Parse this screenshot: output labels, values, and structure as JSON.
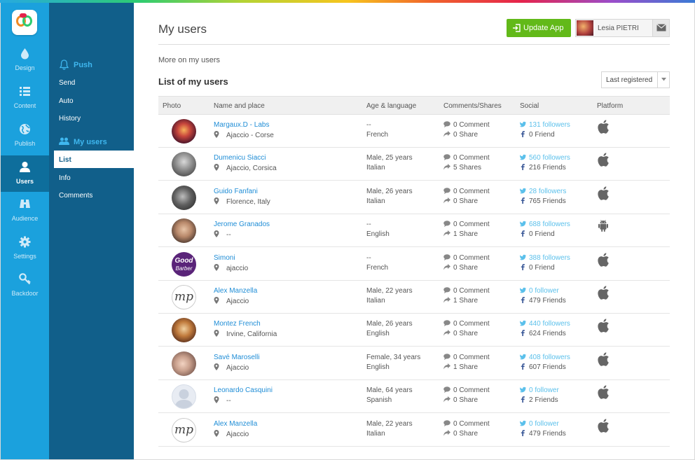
{
  "sidebar": {
    "items": [
      {
        "label": "Design",
        "icon": "drop-icon"
      },
      {
        "label": "Content",
        "icon": "list-icon"
      },
      {
        "label": "Publish",
        "icon": "globe-icon"
      },
      {
        "label": "Users",
        "icon": "user-icon",
        "active": true
      },
      {
        "label": "Audience",
        "icon": "binoculars-icon"
      },
      {
        "label": "Settings",
        "icon": "gear-icon"
      },
      {
        "label": "Backdoor",
        "icon": "key-icon"
      }
    ]
  },
  "subnav": {
    "push_title": "Push",
    "push_items": [
      "Send",
      "Auto",
      "History"
    ],
    "users_title": "My users",
    "users_items": [
      "List",
      "Info",
      "Comments"
    ],
    "active_item": "List"
  },
  "header": {
    "title": "My users",
    "update_button": "Update App",
    "user_name": "Lesia PIETRI"
  },
  "main": {
    "more_link": "More on my users",
    "list_title": "List of my users",
    "sort_value": "Last registered"
  },
  "table": {
    "columns": [
      "Photo",
      "Name and place",
      "Age & language",
      "Comments/Shares",
      "Social",
      "Platform"
    ],
    "rows": [
      {
        "name": "Margaux.D - Labs",
        "place": "Ajaccio - Corse",
        "age": "--",
        "language": "French",
        "comments": "0 Comment",
        "shares": "0 Share",
        "twitter": "131 followers",
        "facebook": "0 Friend",
        "platform": "apple"
      },
      {
        "name": "Dumenicu Siacci",
        "place": "Ajaccio, Corsica",
        "age": "Male, 25 years",
        "language": "Italian",
        "comments": "0 Comment",
        "shares": "5 Shares",
        "twitter": "560 followers",
        "facebook": "216 Friends",
        "platform": "apple"
      },
      {
        "name": "Guido Fanfani",
        "place": "Florence, Italy",
        "age": "Male, 26 years",
        "language": "Italian",
        "comments": "0 Comment",
        "shares": "0 Share",
        "twitter": "28 followers",
        "facebook": "765 Friends",
        "platform": "apple"
      },
      {
        "name": "Jerome Granados",
        "place": "--",
        "age": "--",
        "language": "English",
        "comments": "0 Comment",
        "shares": "1 Share",
        "twitter": "688 followers",
        "facebook": "0 Friend",
        "platform": "android"
      },
      {
        "name": "Simoni",
        "place": "ajaccio",
        "age": "--",
        "language": "French",
        "comments": "0 Comment",
        "shares": "0 Share",
        "twitter": "388 followers",
        "facebook": "0 Friend",
        "platform": "apple"
      },
      {
        "name": "Alex Manzella",
        "place": "Ajaccio",
        "age": "Male, 22 years",
        "language": "Italian",
        "comments": "0 Comment",
        "shares": "1 Share",
        "twitter": "0 follower",
        "facebook": "479 Friends",
        "platform": "apple"
      },
      {
        "name": "Montez French",
        "place": "Irvine, California",
        "age": "Male, 26 years",
        "language": "English",
        "comments": "0 Comment",
        "shares": "0 Share",
        "twitter": "440 followers",
        "facebook": "624 Friends",
        "platform": "apple"
      },
      {
        "name": "Savé Maroselli",
        "place": "Ajaccio",
        "age": "Female, 34 years",
        "language": "English",
        "comments": "0 Comment",
        "shares": "1 Share",
        "twitter": "408 followers",
        "facebook": "607 Friends",
        "platform": "apple"
      },
      {
        "name": "Leonardo Casquini",
        "place": "--",
        "age": "Male, 64 years",
        "language": "Spanish",
        "comments": "0 Comment",
        "shares": "0 Share",
        "twitter": "0 follower",
        "facebook": "2 Friends",
        "platform": "apple"
      },
      {
        "name": "Alex Manzella",
        "place": "Ajaccio",
        "age": "Male, 22 years",
        "language": "Italian",
        "comments": "0 Comment",
        "shares": "0 Share",
        "twitter": "0 follower",
        "facebook": "479 Friends",
        "platform": "apple"
      }
    ],
    "avatar_texts": {
      "goodbarber_1": "Good",
      "goodbarber_2": "Barber",
      "monogram": "mp"
    }
  },
  "colors": {
    "rail": "#1ba1dd",
    "subnav": "#115f8a",
    "accent_green": "#62b919",
    "link_blue": "#1f8dd6",
    "twitter_blue": "#5bc0eb"
  }
}
